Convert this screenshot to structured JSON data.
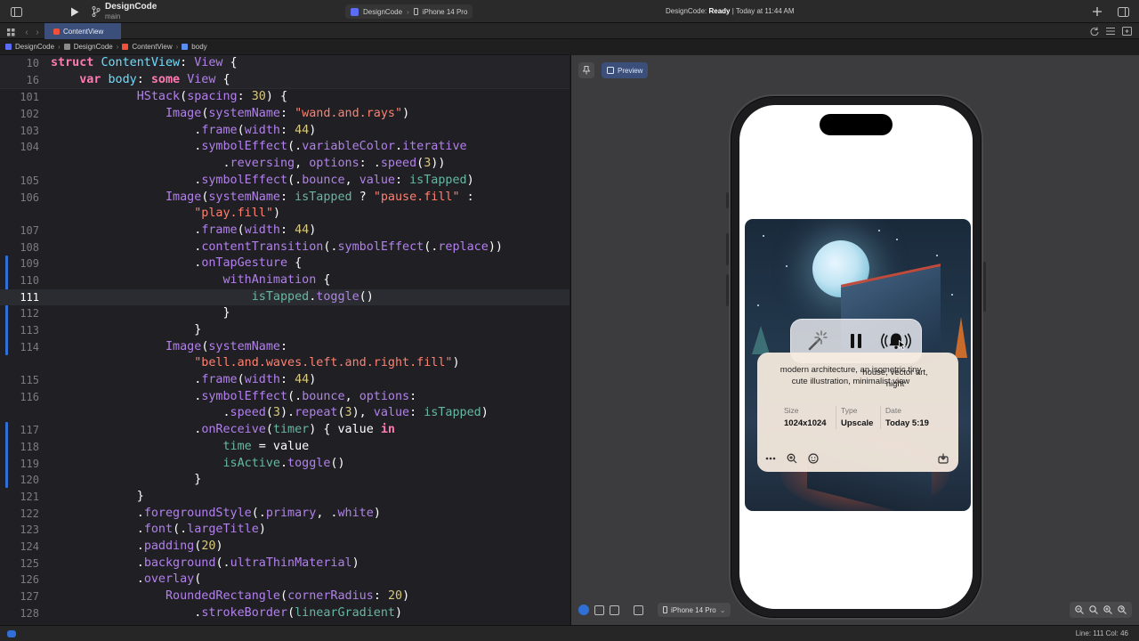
{
  "titlebar": {
    "project": "DesignCode",
    "branch": "main",
    "scheme": "DesignCode",
    "destination": "iPhone 14 Pro",
    "status_prefix": "DesignCode: ",
    "status_state": "Ready",
    "status_time": " | Today at 11:44 AM"
  },
  "tab": {
    "label": "ContentView"
  },
  "breadcrumb": [
    "DesignCode",
    "DesignCode",
    "ContentView",
    "body"
  ],
  "editor": {
    "current_line": "111",
    "lines": [
      {
        "n": "10",
        "src": "struct ContentView: View {"
      },
      {
        "n": "16",
        "src": "    var body: some View {"
      },
      {
        "n": "101",
        "src": "            HStack(spacing: 30) {"
      },
      {
        "n": "102",
        "src": "                Image(systemName: \"wand.and.rays\")"
      },
      {
        "n": "103",
        "src": "                    .frame(width: 44)"
      },
      {
        "n": "104",
        "src": "                    .symbolEffect(.variableColor.iterative"
      },
      {
        "n": "",
        "src": "                        .reversing, options: .speed(3))"
      },
      {
        "n": "105",
        "src": "                    .symbolEffect(.bounce, value: isTapped)"
      },
      {
        "n": "106",
        "src": "                Image(systemName: isTapped ? \"pause.fill\" :"
      },
      {
        "n": "",
        "src": "                    \"play.fill\")"
      },
      {
        "n": "107",
        "src": "                    .frame(width: 44)"
      },
      {
        "n": "108",
        "src": "                    .contentTransition(.symbolEffect(.replace))"
      },
      {
        "n": "109",
        "src": "                    .onTapGesture {"
      },
      {
        "n": "110",
        "src": "                        withAnimation {"
      },
      {
        "n": "111",
        "src": "                            isTapped.toggle()"
      },
      {
        "n": "112",
        "src": "                        }"
      },
      {
        "n": "113",
        "src": "                    }"
      },
      {
        "n": "114",
        "src": "                Image(systemName:"
      },
      {
        "n": "",
        "src": "                    \"bell.and.waves.left.and.right.fill\")"
      },
      {
        "n": "115",
        "src": "                    .frame(width: 44)"
      },
      {
        "n": "116",
        "src": "                    .symbolEffect(.bounce, options:"
      },
      {
        "n": "",
        "src": "                        .speed(3).repeat(3), value: isTapped)"
      },
      {
        "n": "117",
        "src": "                    .onReceive(timer) { value in"
      },
      {
        "n": "118",
        "src": "                        time = value"
      },
      {
        "n": "119",
        "src": "                        isActive.toggle()"
      },
      {
        "n": "120",
        "src": "                    }"
      },
      {
        "n": "121",
        "src": "            }"
      },
      {
        "n": "122",
        "src": "            .foregroundStyle(.primary, .white)"
      },
      {
        "n": "123",
        "src": "            .font(.largeTitle)"
      },
      {
        "n": "124",
        "src": "            .padding(20)"
      },
      {
        "n": "125",
        "src": "            .background(.ultraThinMaterial)"
      },
      {
        "n": "126",
        "src": "            .overlay("
      },
      {
        "n": "127",
        "src": "                RoundedRectangle(cornerRadius: 20)"
      },
      {
        "n": "128",
        "src": "                    .strokeBorder(linearGradient)"
      }
    ]
  },
  "canvas": {
    "preview_label": "Preview",
    "device": "iPhone 14 Pro",
    "card": {
      "prompt_a": "modern architecture, an isometric tiny cute illustration, minimalist view",
      "prompt_b": "house, vector art, night",
      "size_label": "Size",
      "size_value": "1024x1024",
      "type_label": "Type",
      "type_value": "Upscale",
      "date_label": "Date",
      "date_value": "Today 5:19"
    }
  },
  "statusbar": {
    "position": "Line: 111  Col: 46"
  },
  "colors": {
    "accent": "#2f6fd6",
    "tab_selected": "#3b4f7a"
  },
  "icons": [
    "sidebar-icon",
    "play-icon",
    "branch-icon",
    "plus-icon",
    "split-view-icon",
    "wand-and-rays-icon",
    "pause-icon",
    "bell-and-waves-icon",
    "ellipsis-icon",
    "zoom-icon",
    "smiley-icon",
    "download-icon"
  ]
}
